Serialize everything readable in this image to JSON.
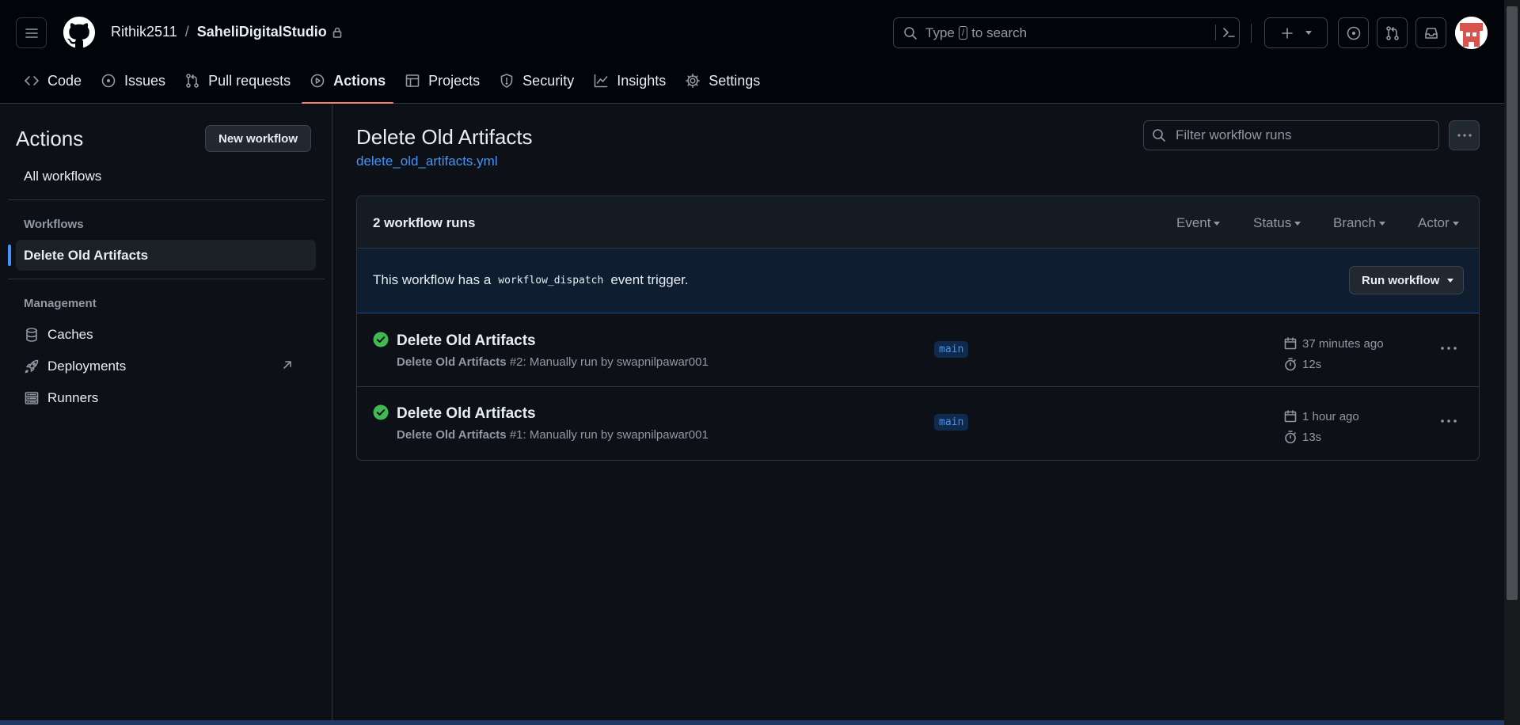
{
  "header": {
    "repo_owner": "Rithik2511",
    "repo_separator": "/",
    "repo_name": "SaheliDigitalStudio",
    "search_prefix": "Type",
    "search_key": "/",
    "search_suffix": "to search"
  },
  "nav": {
    "tabs": [
      {
        "label": "Code",
        "icon": "code-icon"
      },
      {
        "label": "Issues",
        "icon": "issue-opened-icon"
      },
      {
        "label": "Pull requests",
        "icon": "git-pull-request-icon"
      },
      {
        "label": "Actions",
        "icon": "play-icon",
        "active": true
      },
      {
        "label": "Projects",
        "icon": "table-icon"
      },
      {
        "label": "Security",
        "icon": "shield-icon"
      },
      {
        "label": "Insights",
        "icon": "graph-icon"
      },
      {
        "label": "Settings",
        "icon": "gear-icon"
      }
    ]
  },
  "sidebar": {
    "title": "Actions",
    "new_workflow_label": "New workflow",
    "all_workflows_label": "All workflows",
    "workflows_heading": "Workflows",
    "selected_workflow": "Delete Old Artifacts",
    "management_heading": "Management",
    "management_items": [
      {
        "label": "Caches",
        "icon": "database-icon"
      },
      {
        "label": "Deployments",
        "icon": "rocket-icon",
        "external": true
      },
      {
        "label": "Runners",
        "icon": "server-icon"
      }
    ]
  },
  "main": {
    "title": "Delete Old Artifacts",
    "file_link": "delete_old_artifacts.yml",
    "filter_placeholder": "Filter workflow runs",
    "runs_count": "2 workflow runs",
    "filters": [
      "Event",
      "Status",
      "Branch",
      "Actor"
    ],
    "dispatch_text_before": "This workflow has a",
    "dispatch_code": "workflow_dispatch",
    "dispatch_text_after": "event trigger.",
    "run_workflow_label": "Run workflow",
    "runs": [
      {
        "title": "Delete Old Artifacts",
        "workflow": "Delete Old Artifacts",
        "detail": "#2: Manually run by swapnilpawar001",
        "branch": "main",
        "when": "37 minutes ago",
        "duration": "12s",
        "status": "success"
      },
      {
        "title": "Delete Old Artifacts",
        "workflow": "Delete Old Artifacts",
        "detail": "#1: Manually run by swapnilpawar001",
        "branch": "main",
        "when": "1 hour ago",
        "duration": "13s",
        "status": "success"
      }
    ]
  },
  "colors": {
    "background": "#0d1117",
    "header_bg": "#010409",
    "accent_link": "#4493f8",
    "active_tab_underline": "#f78166",
    "success": "#3fb950"
  }
}
